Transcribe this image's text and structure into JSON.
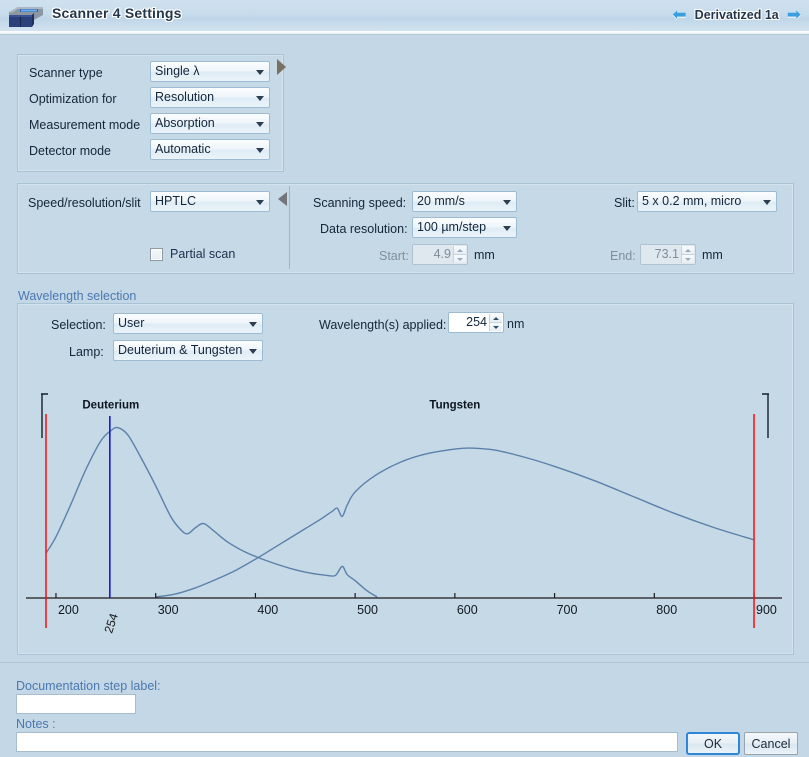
{
  "window": {
    "title": "Scanner 4 Settings",
    "icon": "scanner-device-icon",
    "nav_label": "Derivatized 1a",
    "prev_arrow": "←",
    "next_arrow": "→"
  },
  "basic_panel": {
    "rows": [
      {
        "label": "Scanner type",
        "value": "Single λ"
      },
      {
        "label": "Optimization for",
        "value": "Resolution"
      },
      {
        "label": "Measurement mode",
        "value": "Absorption"
      },
      {
        "label": "Detector mode",
        "value": "Automatic"
      }
    ]
  },
  "speed_panel": {
    "preset_label": "Speed/resolution/slit",
    "preset_value": "HPTLC",
    "partial_scan_label": "Partial scan",
    "partial_scan_checked": false,
    "scanning_speed_label": "Scanning speed:",
    "scanning_speed_value": "20 mm/s",
    "data_resolution_label": "Data resolution:",
    "data_resolution_value": "100 µm/step",
    "slit_label": "Slit:",
    "slit_value": "5 x 0.2 mm, micro",
    "start_label": "Start:",
    "start_value": "4.9",
    "start_unit": "mm",
    "end_label": "End:",
    "end_value": "73.1",
    "end_unit": "mm"
  },
  "wavelength": {
    "group_label": "Wavelength selection",
    "selection_label": "Selection:",
    "selection_value": "User",
    "lamp_label": "Lamp:",
    "lamp_value": "Deuterium & Tungsten",
    "applied_label": "Wavelength(s) applied:",
    "applied_value": "254",
    "applied_unit": "nm"
  },
  "chart_data": {
    "type": "line",
    "title": "",
    "xlabel": "",
    "ylabel": "",
    "xlim": [
      190,
      910
    ],
    "ylim": [
      0,
      1
    ],
    "grid": false,
    "legend": "inline-annotations",
    "xticks": [
      200,
      300,
      400,
      500,
      600,
      700,
      800,
      900
    ],
    "annotations": [
      {
        "text": "Deuterium",
        "x": 255,
        "y": 0.93
      },
      {
        "text": "Tungsten",
        "x": 600,
        "y": 0.93
      }
    ],
    "markers": [
      {
        "name": "range-start",
        "x": 190,
        "color": "#ff0000",
        "label": ""
      },
      {
        "name": "range-end",
        "x": 900,
        "color": "#ff0000",
        "label": ""
      },
      {
        "name": "selected-wavelength",
        "x": 254,
        "color": "#1818d8",
        "label": "254"
      }
    ],
    "series": [
      {
        "name": "Deuterium",
        "color": "#5b81ab",
        "x": [
          190,
          200,
          215,
          230,
          245,
          255,
          262,
          272,
          285,
          300,
          315,
          325,
          332,
          340,
          348,
          358,
          372,
          390,
          410,
          435,
          455,
          470,
          480,
          487,
          492,
          500,
          512,
          522
        ],
        "y": [
          0.22,
          0.3,
          0.46,
          0.63,
          0.77,
          0.82,
          0.835,
          0.8,
          0.69,
          0.55,
          0.4,
          0.335,
          0.315,
          0.345,
          0.365,
          0.33,
          0.275,
          0.225,
          0.185,
          0.145,
          0.122,
          0.112,
          0.11,
          0.155,
          0.115,
          0.085,
          0.035,
          0.005
        ]
      },
      {
        "name": "Tungsten",
        "color": "#5b81ab",
        "x": [
          300,
          320,
          340,
          360,
          380,
          400,
          425,
          450,
          465,
          477,
          482,
          487,
          492,
          500,
          520,
          545,
          570,
          600,
          615,
          640,
          670,
          700,
          740,
          780,
          820,
          860,
          900
        ],
        "y": [
          0.005,
          0.02,
          0.05,
          0.09,
          0.135,
          0.19,
          0.265,
          0.34,
          0.385,
          0.425,
          0.44,
          0.4,
          0.455,
          0.52,
          0.6,
          0.665,
          0.705,
          0.73,
          0.735,
          0.725,
          0.69,
          0.645,
          0.575,
          0.495,
          0.415,
          0.345,
          0.285
        ]
      }
    ]
  },
  "footer": {
    "doc_label": "Documentation step label:",
    "doc_value": "",
    "notes_label": "Notes :",
    "notes_value": "",
    "ok_label": "OK",
    "cancel_label": "Cancel"
  }
}
